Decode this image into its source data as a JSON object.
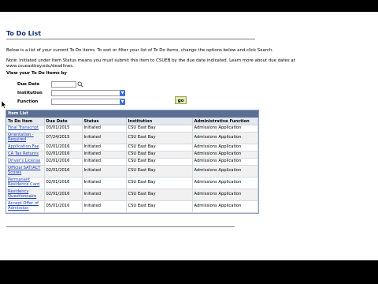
{
  "page": {
    "title": "To Do List",
    "intro": "Below is a list of your current To Do items.  To sort or filter your list of To Do items, change the options below and click Search.",
    "note": "Note: Initiated under Item Status means you must submit this item to CSUEB by the due date indicated.   Learn more about due dates at www.csueastbay.edu/deadlines.",
    "view_by": "View your To Do Items by"
  },
  "filters": {
    "due_date_label": "Due Date",
    "due_date_value": "",
    "institution_label": "Institution",
    "institution_value": "",
    "function_label": "Function",
    "function_value": "",
    "go_label": "go"
  },
  "item_list": {
    "title": "Item List",
    "columns": [
      "To Do Item",
      "Due Date",
      "Status",
      "Institution",
      "Administrative Function"
    ],
    "rows": [
      {
        "item": "Final Transcript",
        "due": "03/01/2015",
        "status": "Initiated",
        "institution": "CSU East Bay",
        "function": "Admissions Application"
      },
      {
        "item": "Orientation - Required",
        "due": "07/24/2015",
        "status": "Initiated",
        "institution": "CSU East Bay",
        "function": "Admissions Application"
      },
      {
        "item": "Application Fee",
        "due": "02/01/2016",
        "status": "Initiated",
        "institution": "CSU East Bay",
        "function": "Admissions Application"
      },
      {
        "item": "CA Tax Returns",
        "due": "02/01/2016",
        "status": "Initiated",
        "institution": "CSU East Bay",
        "function": "Admissions Application"
      },
      {
        "item": "Driver's License",
        "due": "02/01/2016",
        "status": "Initiated",
        "institution": "CSU East Bay",
        "function": "Admissions Application"
      },
      {
        "item": "Official SAT/ACT Scores",
        "due": "02/01/2016",
        "status": "Initiated",
        "institution": "CSU East Bay",
        "function": "Admissions Application"
      },
      {
        "item": "Permanent Residence Card",
        "due": "02/01/2016",
        "status": "Initiated",
        "institution": "CSU East Bay",
        "function": "Admissions Application"
      },
      {
        "item": "Residency Questionnaire",
        "due": "02/01/2016",
        "status": "Initiated",
        "institution": "CSU East Bay",
        "function": "Admissions Application"
      },
      {
        "item": "Accept Offer of Admission",
        "due": "05/01/2016",
        "status": "Initiated",
        "institution": "CSU East Bay",
        "function": "Admissions Application"
      }
    ]
  },
  "colors": {
    "title": "#0f2e6e",
    "list_header": "#5b6f94",
    "link": "#1a3fb0",
    "go_button": "#dfe8b0"
  }
}
